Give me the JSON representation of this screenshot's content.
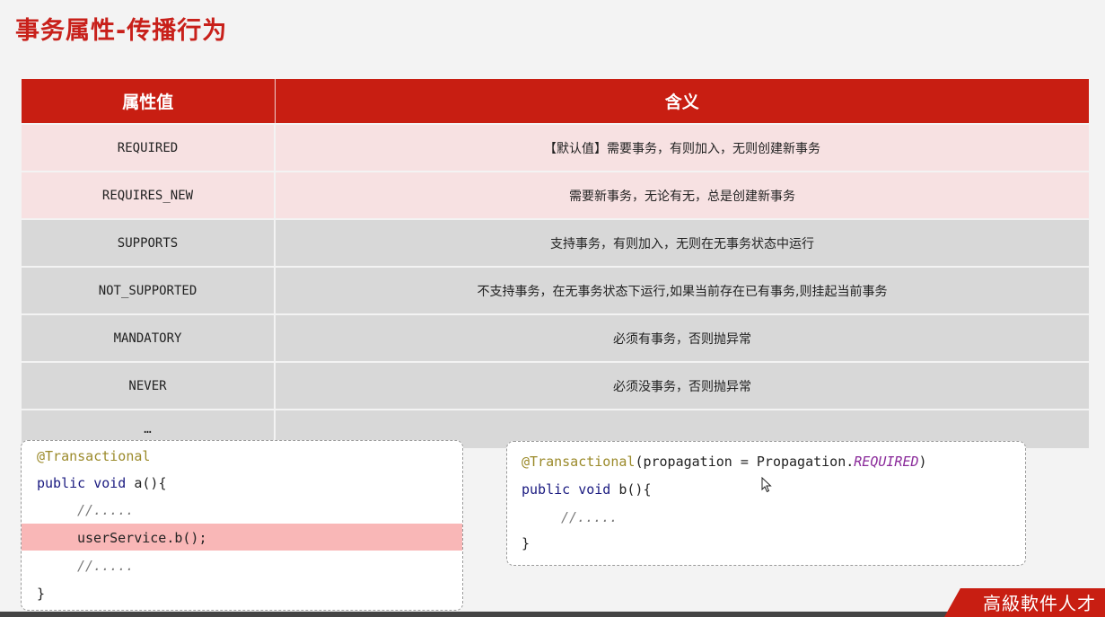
{
  "title": "事务属性-传播行为",
  "table": {
    "headers": [
      "属性值",
      "含义"
    ],
    "rows": [
      {
        "value": "REQUIRED",
        "meaning": "【默认值】需要事务，有则加入，无则创建新事务"
      },
      {
        "value": "REQUIRES_NEW",
        "meaning": "需要新事务，无论有无，总是创建新事务"
      },
      {
        "value": "SUPPORTS",
        "meaning": "支持事务，有则加入，无则在无事务状态中运行"
      },
      {
        "value": "NOT_SUPPORTED",
        "meaning": "不支持事务，在无事务状态下运行,如果当前存在已有事务,则挂起当前事务"
      },
      {
        "value": "MANDATORY",
        "meaning": "必须有事务，否则抛异常"
      },
      {
        "value": "NEVER",
        "meaning": "必须没事务，否则抛异常"
      },
      {
        "value": "…",
        "meaning": ""
      }
    ]
  },
  "code_left": {
    "annotation": "@Transactional",
    "keywords": "public void ",
    "method": "a(){",
    "comment1": "//.....",
    "call": "userService.b();",
    "comment2": "//.....",
    "close": "}"
  },
  "code_right": {
    "annotation": "@Transactional",
    "params_open": "(propagation = Propagation.",
    "enum_value": "REQUIRED",
    "params_close": ")",
    "keywords": "public void ",
    "method": "b(){",
    "comment": "//.....",
    "close": "}"
  },
  "logo": "高級軟件人才"
}
